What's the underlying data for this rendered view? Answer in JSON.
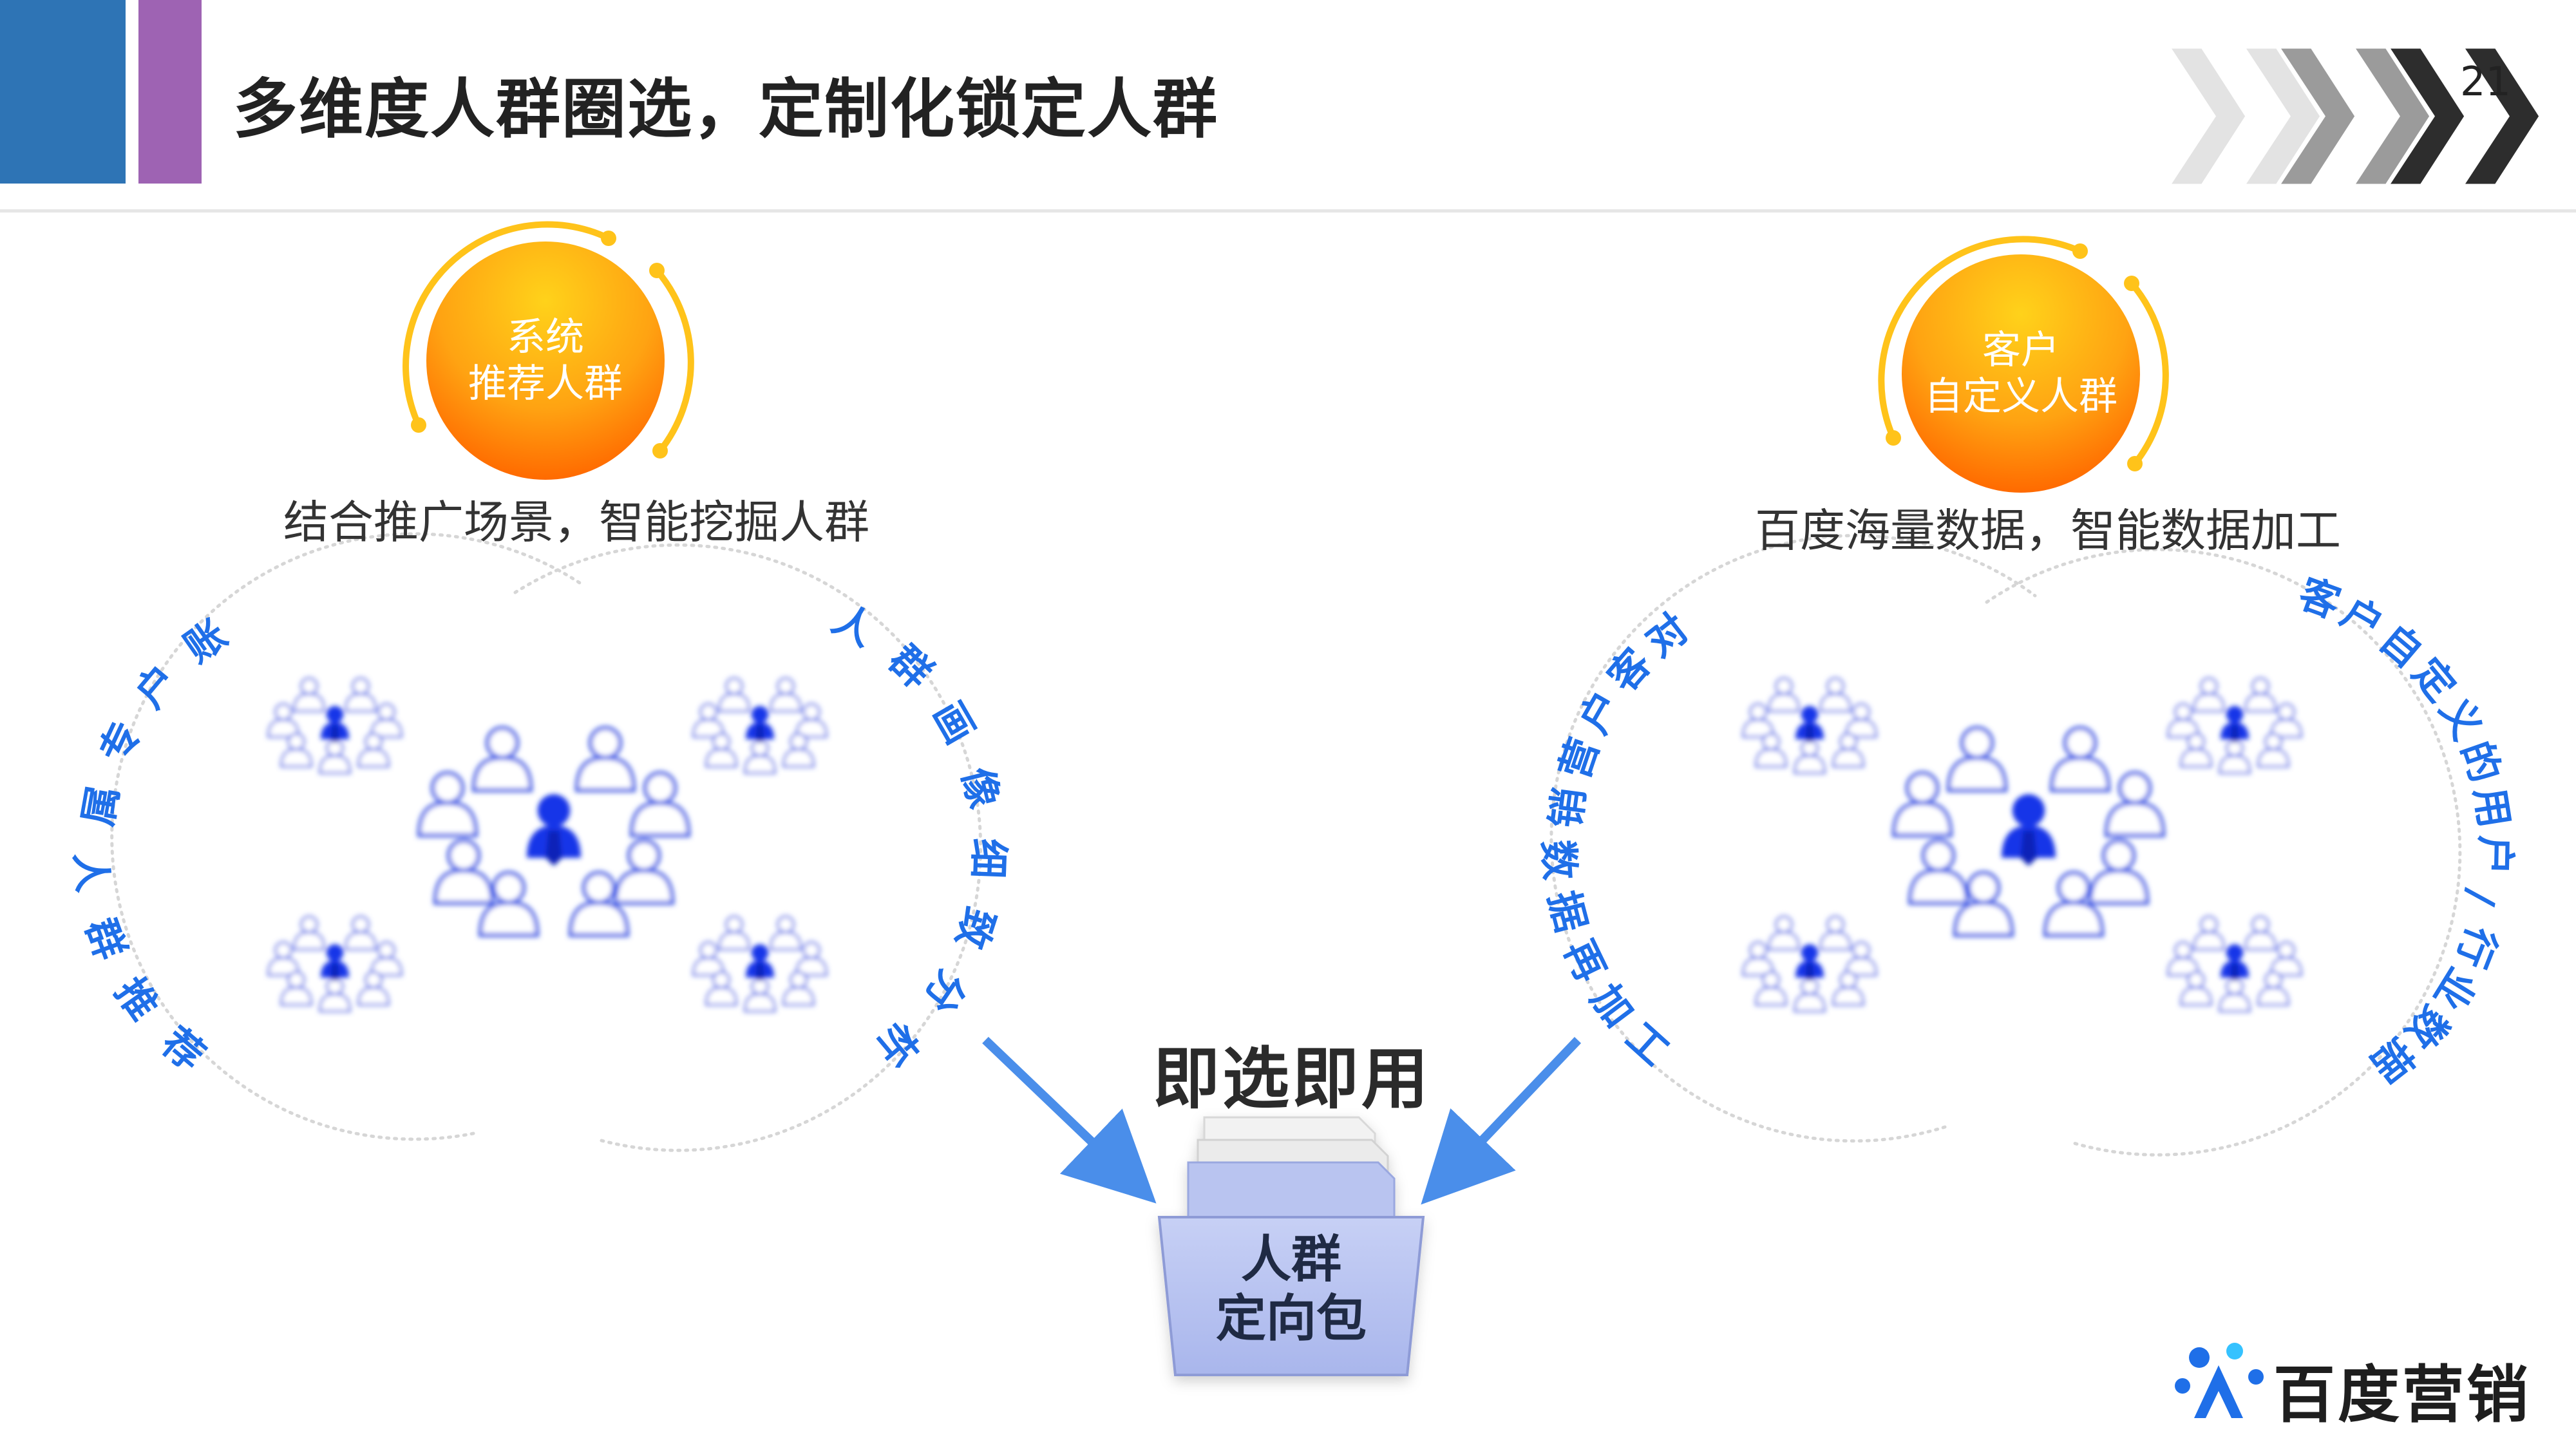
{
  "header": {
    "title": "多维度人群圈选，定制化锁定人群",
    "page_number": "21"
  },
  "left": {
    "badge": [
      "系统",
      "推荐人群"
    ],
    "caption": "结合推广场景，智能挖掘人群",
    "arc_left_text": "账户专属人群推荐",
    "arc_right_text": "人群画像细致分析"
  },
  "right": {
    "badge": [
      "客户",
      "自定义人群"
    ],
    "caption": "百度海量数据，智能数据加工",
    "arc_left_text": "对客户营销数据再加工",
    "arc_right_text": "客户自定义的用户/行业数据"
  },
  "center": {
    "title": "即选即用",
    "folder": [
      "人群",
      "定向包"
    ]
  },
  "brand": {
    "name": "百度营销"
  },
  "colors": {
    "blue_bar": "#2e74b5",
    "purple_bar": "#9e63b3",
    "accent_blue": "#1f6fe8",
    "badge_orange": "#ff8c00"
  }
}
